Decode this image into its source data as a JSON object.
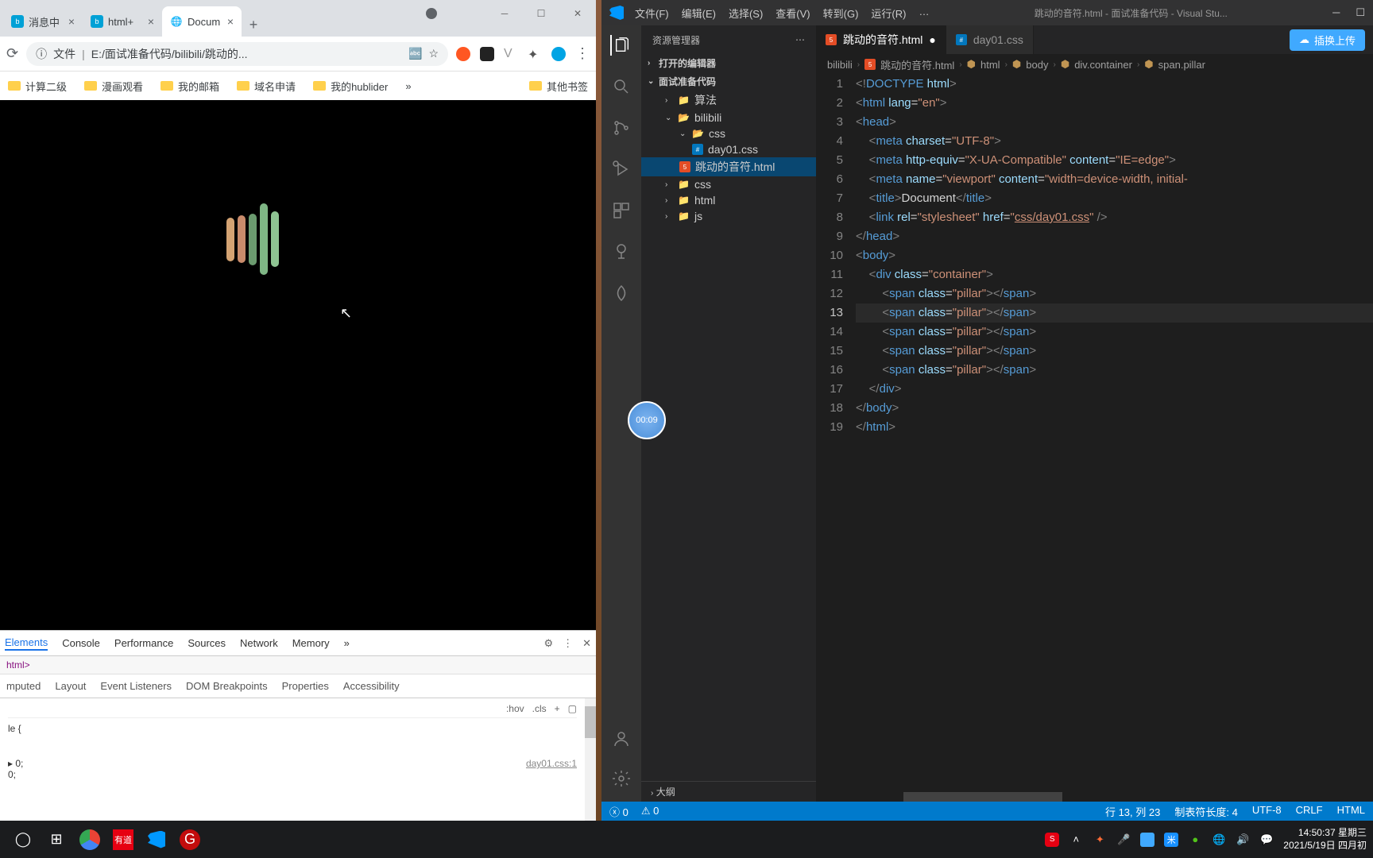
{
  "chrome": {
    "tabs": [
      {
        "label": "消息中",
        "favicon": "bili"
      },
      {
        "label": "html+",
        "favicon": "bili"
      },
      {
        "label": "Docum",
        "favicon": "globe",
        "active": true
      }
    ],
    "url_prefix": "文件",
    "url": "E:/面试准备代码/bilibili/跳动的...",
    "bookmarks": [
      "计算二级",
      "漫画观看",
      "我的邮箱",
      "域名申请",
      "我的hublider"
    ],
    "bm_other": "其他书签",
    "bm_more": "»"
  },
  "timestamp": "00:09",
  "devtools": {
    "tabs": [
      "Elements",
      "Console",
      "Performance",
      "Sources",
      "Network",
      "Memory"
    ],
    "more": "»",
    "tag": "html>",
    "subtabs": [
      "mputed",
      "Layout",
      "Event Listeners",
      "DOM Breakpoints",
      "Properties",
      "Accessibility"
    ],
    "hov": ":hov",
    "cls": ".cls",
    "rule": "le {",
    "rule2": "▸ 0;",
    "rule3": "  0;",
    "source": "day01.css:1"
  },
  "vscode": {
    "menus": [
      "文件(F)",
      "编辑(E)",
      "选择(S)",
      "查看(V)",
      "转到(G)",
      "运行(R)",
      "…"
    ],
    "title": "跳动的音符.html - 面试准备代码 - Visual Stu...",
    "explorer": "资源管理器",
    "open_editors": "打开的编辑器",
    "project": "面试准备代码",
    "tree": {
      "suanfa": "算法",
      "bilibili": "bilibili",
      "css": "css",
      "day01": "day01.css",
      "file": "跳动的音符.html",
      "css2": "css",
      "html": "html",
      "js": "js"
    },
    "outline": "大纲",
    "tabs": [
      {
        "label": "跳动的音符.html",
        "icon": "html",
        "active": true,
        "dirty": true
      },
      {
        "label": "day01.css",
        "icon": "css"
      }
    ],
    "upload": "插换上传",
    "breadcrumb": [
      "bilibili",
      "跳动的音符.html",
      "html",
      "body",
      "div.container",
      "span.pillar"
    ],
    "status": {
      "errors": "0",
      "warnings": "0",
      "pos": "行 13, 列 23",
      "tab": "制表符长度: 4",
      "enc": "UTF-8",
      "eol": "CRLF",
      "lang": "HTML"
    }
  },
  "clock": {
    "time": "14:50:37",
    "day": "星期三",
    "date": "2021/5/19日 四月初"
  }
}
